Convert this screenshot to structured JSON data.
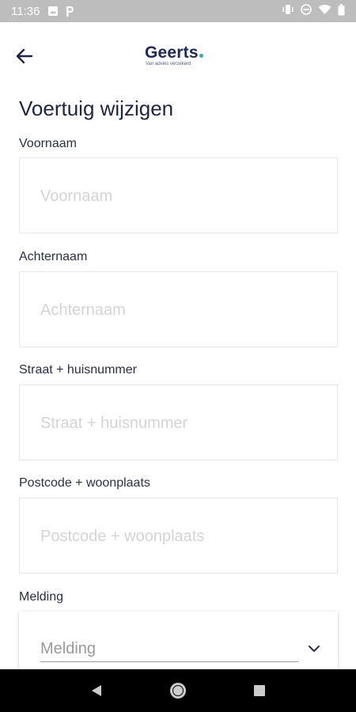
{
  "status_bar": {
    "time": "11:36",
    "left_icons": [
      "image-icon",
      "parking-icon"
    ],
    "right_icons": [
      "vibrate-icon",
      "do-not-disturb-icon",
      "wifi-icon",
      "battery-icon"
    ]
  },
  "header": {
    "back_icon": "arrow-left-icon",
    "logo_text": "Geerts",
    "logo_tagline": "Van advies verzekerd",
    "logo_dot_color": "#2bb5a0"
  },
  "page": {
    "title": "Voertuig wijzigen"
  },
  "form": {
    "fields": [
      {
        "label": "Voornaam",
        "placeholder": "Voornaam",
        "value": ""
      },
      {
        "label": "Achternaam",
        "placeholder": "Achternaam",
        "value": ""
      },
      {
        "label": "Straat + huisnummer",
        "placeholder": "Straat + huisnummer",
        "value": ""
      },
      {
        "label": "Postcode + woonplaats",
        "placeholder": "Postcode + woonplaats",
        "value": ""
      }
    ],
    "melding": {
      "label": "Melding",
      "selected": "Melding",
      "icon": "chevron-down-icon"
    }
  },
  "nav_bar": {
    "buttons": [
      "back-triangle-icon",
      "home-circle-icon",
      "recents-square-icon"
    ]
  },
  "colors": {
    "primary_text": "#1e2444",
    "placeholder": "#d4d4d4",
    "status_bar_bg": "#bdbdbd",
    "nav_bar_bg": "#000000"
  }
}
